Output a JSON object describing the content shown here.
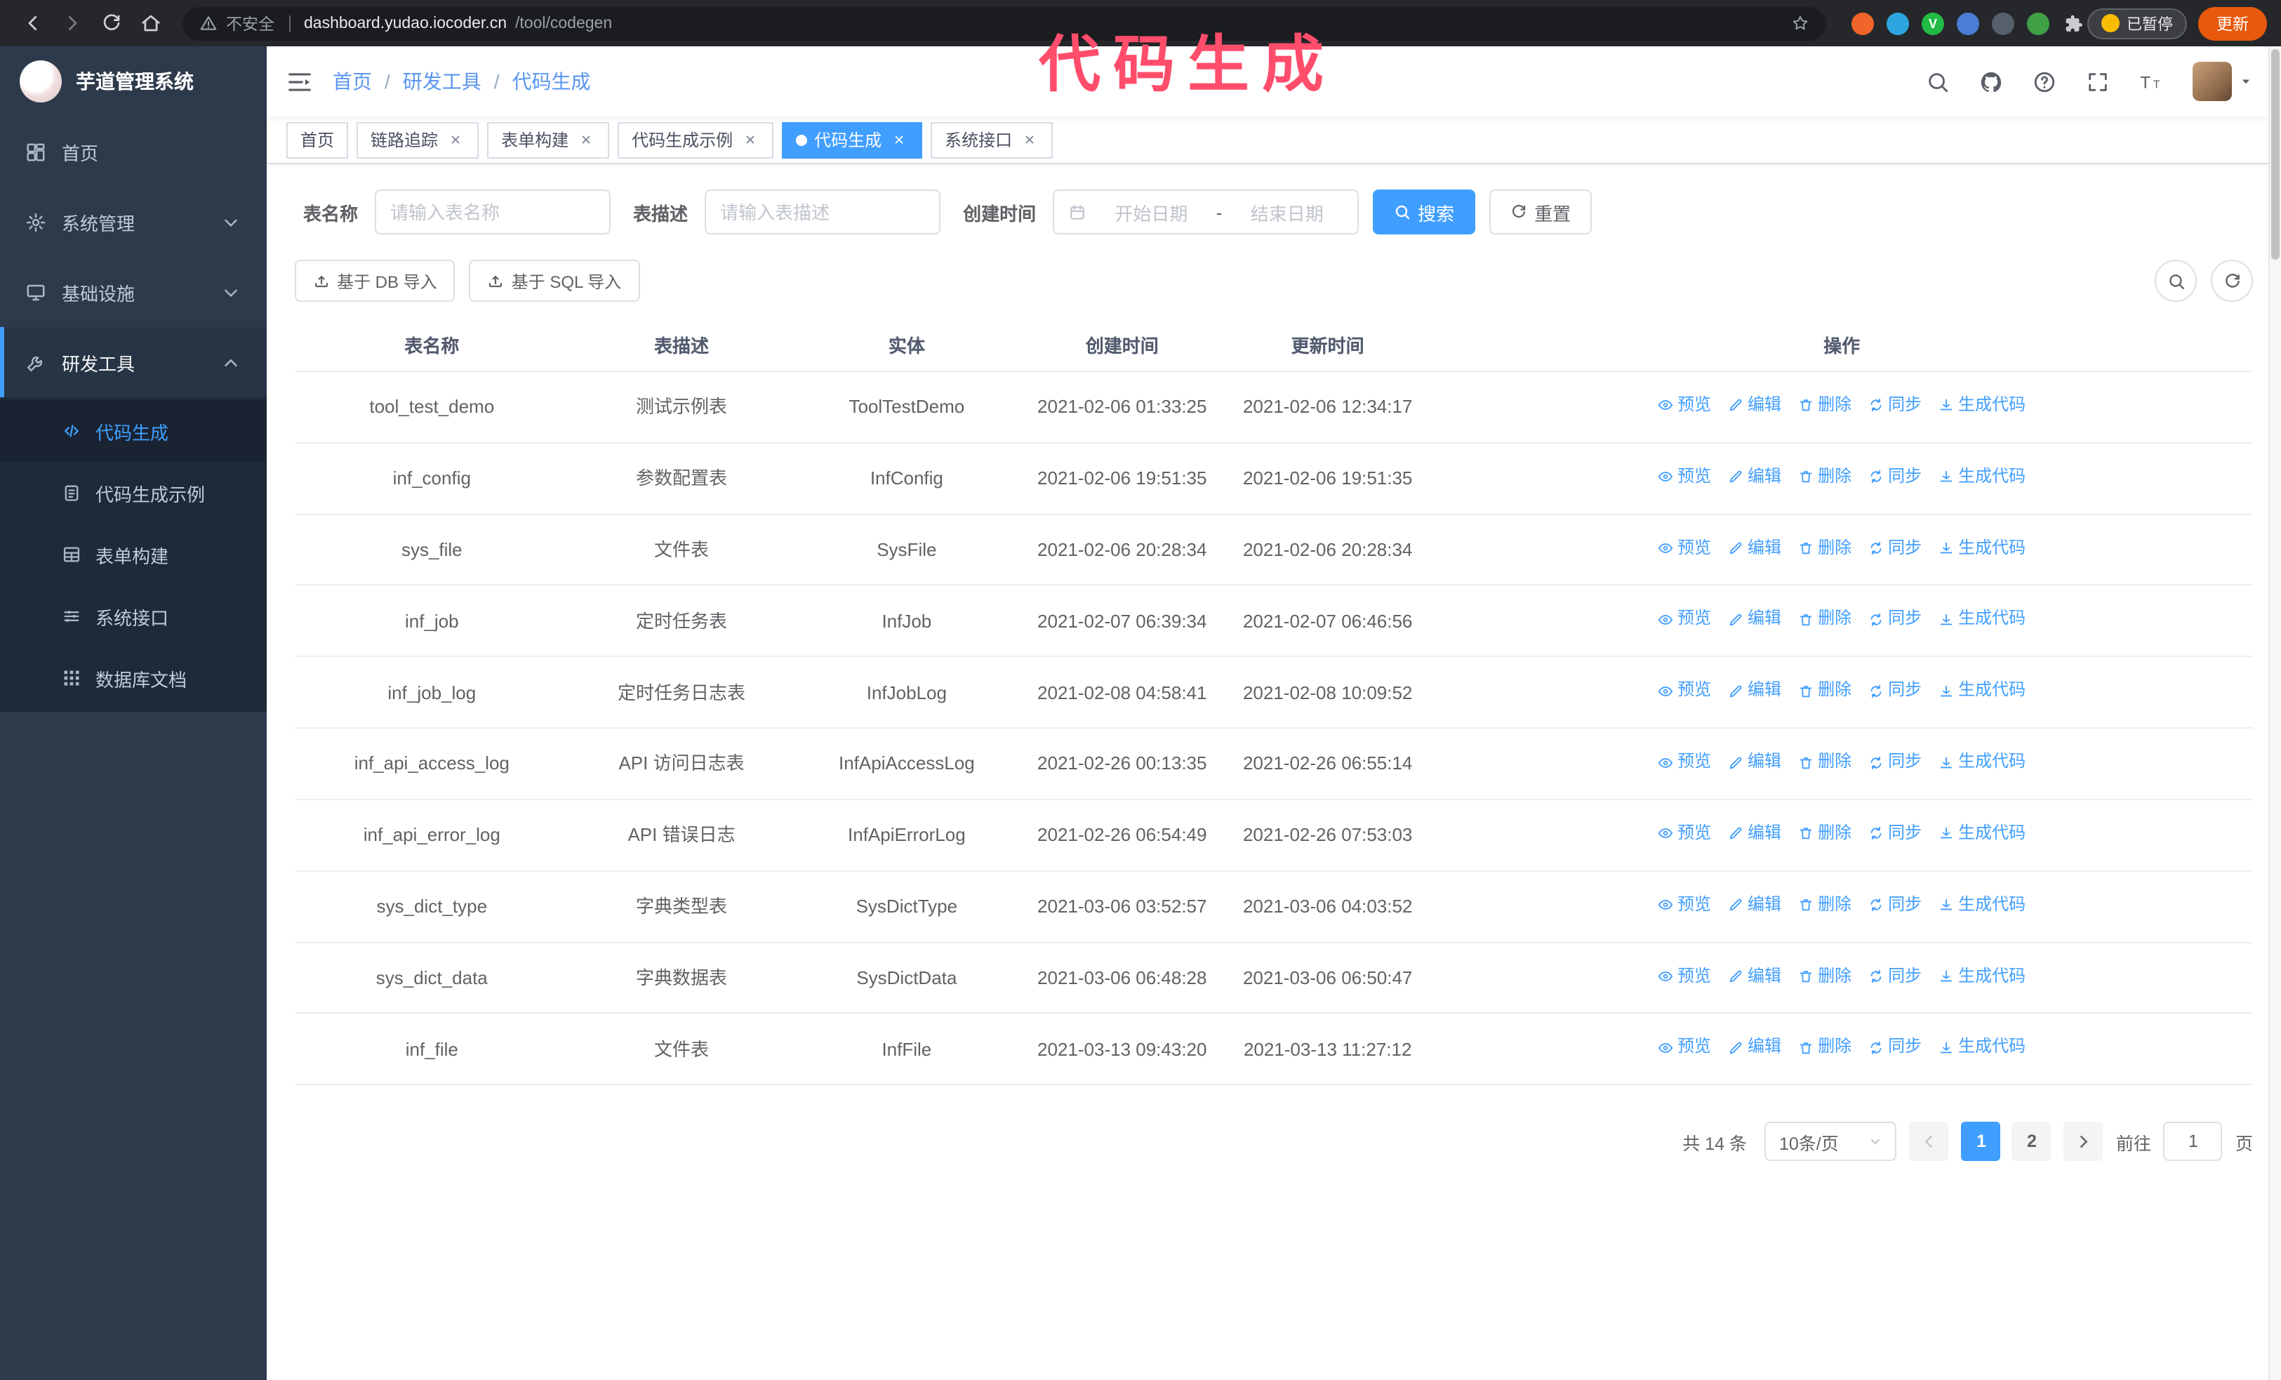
{
  "browser": {
    "security_label": "不安全",
    "url_host": "dashboard.yudao.iocoder.cn",
    "url_path": "/tool/codegen",
    "paused_label": "已暂停",
    "update_label": "更新",
    "extensions": [
      {
        "key": "fox",
        "color": "#f0652a",
        "glyph": ""
      },
      {
        "key": "drop",
        "color": "#2da6e0",
        "glyph": ""
      },
      {
        "key": "v-check",
        "color": "#21ba45",
        "glyph": "V"
      },
      {
        "key": "users",
        "color": "#4a7dd6",
        "glyph": ""
      },
      {
        "key": "palette",
        "color": "#56606b",
        "glyph": ""
      },
      {
        "key": "leaf",
        "color": "#3fa045",
        "glyph": ""
      }
    ]
  },
  "overlay": {
    "text": "代码生成"
  },
  "sidebar": {
    "logo_title": "芋道管理系统",
    "items": [
      {
        "key": "home",
        "label": "首页",
        "icon": "dashboard"
      },
      {
        "key": "system",
        "label": "系统管理",
        "icon": "gear",
        "expandable": true
      },
      {
        "key": "infra",
        "label": "基础设施",
        "icon": "monitor",
        "expandable": true
      },
      {
        "key": "devtools",
        "label": "研发工具",
        "icon": "wrench",
        "expandable": true,
        "expanded": true,
        "children": [
          {
            "key": "codegen",
            "label": "代码生成",
            "icon": "code",
            "active": true
          },
          {
            "key": "codegen-example",
            "label": "代码生成示例",
            "icon": "clipboard"
          },
          {
            "key": "form-build",
            "label": "表单构建",
            "icon": "formgrid"
          },
          {
            "key": "api",
            "label": "系统接口",
            "icon": "sliders"
          },
          {
            "key": "db-doc",
            "label": "数据库文档",
            "icon": "gridsq"
          }
        ]
      }
    ]
  },
  "navbar": {
    "breadcrumb": [
      "首页",
      "研发工具",
      "代码生成"
    ]
  },
  "tabs": [
    {
      "key": "home",
      "label": "首页",
      "closable": false,
      "active": false
    },
    {
      "key": "trace",
      "label": "链路追踪",
      "closable": true,
      "active": false
    },
    {
      "key": "form-build",
      "label": "表单构建",
      "closable": true,
      "active": false
    },
    {
      "key": "codegen-example",
      "label": "代码生成示例",
      "closable": true,
      "active": false
    },
    {
      "key": "codegen",
      "label": "代码生成",
      "closable": true,
      "active": true
    },
    {
      "key": "api",
      "label": "系统接口",
      "closable": true,
      "active": false
    }
  ],
  "filters": {
    "table_name_label": "表名称",
    "table_name_placeholder": "请输入表名称",
    "table_desc_label": "表描述",
    "table_desc_placeholder": "请输入表描述",
    "create_time_label": "创建时间",
    "date_start_placeholder": "开始日期",
    "date_separator": "-",
    "date_end_placeholder": "结束日期",
    "search_button": "搜索",
    "reset_button": "重置"
  },
  "toolbar": {
    "import_db_button": "基于 DB 导入",
    "import_sql_button": "基于 SQL 导入"
  },
  "table": {
    "columns": [
      "表名称",
      "表描述",
      "实体",
      "创建时间",
      "更新时间",
      "操作"
    ],
    "ops": [
      {
        "key": "preview",
        "label": "预览",
        "icon": "eye"
      },
      {
        "key": "edit",
        "label": "编辑",
        "icon": "pencil"
      },
      {
        "key": "delete",
        "label": "删除",
        "icon": "trash"
      },
      {
        "key": "sync",
        "label": "同步",
        "icon": "sync"
      },
      {
        "key": "generate",
        "label": "生成代码",
        "icon": "download"
      }
    ],
    "rows": [
      {
        "name": "tool_test_demo",
        "desc": "测试示例表",
        "entity": "ToolTestDemo",
        "created": "2021-02-06 01:33:25",
        "updated": "2021-02-06 12:34:17"
      },
      {
        "name": "inf_config",
        "desc": "参数配置表",
        "entity": "InfConfig",
        "created": "2021-02-06 19:51:35",
        "updated": "2021-02-06 19:51:35"
      },
      {
        "name": "sys_file",
        "desc": "文件表",
        "entity": "SysFile",
        "created": "2021-02-06 20:28:34",
        "updated": "2021-02-06 20:28:34"
      },
      {
        "name": "inf_job",
        "desc": "定时任务表",
        "entity": "InfJob",
        "created": "2021-02-07 06:39:34",
        "updated": "2021-02-07 06:46:56"
      },
      {
        "name": "inf_job_log",
        "desc": "定时任务日志表",
        "entity": "InfJobLog",
        "created": "2021-02-08 04:58:41",
        "updated": "2021-02-08 10:09:52"
      },
      {
        "name": "inf_api_access_log",
        "desc": "API 访问日志表",
        "entity": "InfApiAccessLog",
        "created": "2021-02-26 00:13:35",
        "updated": "2021-02-26 06:55:14"
      },
      {
        "name": "inf_api_error_log",
        "desc": "API 错误日志",
        "entity": "InfApiErrorLog",
        "created": "2021-02-26 06:54:49",
        "updated": "2021-02-26 07:53:03"
      },
      {
        "name": "sys_dict_type",
        "desc": "字典类型表",
        "entity": "SysDictType",
        "created": "2021-03-06 03:52:57",
        "updated": "2021-03-06 04:03:52"
      },
      {
        "name": "sys_dict_data",
        "desc": "字典数据表",
        "entity": "SysDictData",
        "created": "2021-03-06 06:48:28",
        "updated": "2021-03-06 06:50:47"
      },
      {
        "name": "inf_file",
        "desc": "文件表",
        "entity": "InfFile",
        "created": "2021-03-13 09:43:20",
        "updated": "2021-03-13 11:27:12"
      }
    ]
  },
  "pagination": {
    "total_text": "共 14 条",
    "page_size": "10条/页",
    "pages": [
      "1",
      "2"
    ],
    "active_page": "1",
    "goto_label": "前往",
    "goto_value": "1",
    "goto_suffix": "页"
  },
  "colors": {
    "accent": "#409EFF",
    "sidebar_bg": "#2d3a4b",
    "overlay": "#ff4d6b",
    "update_button_bg": "#e8590c"
  }
}
